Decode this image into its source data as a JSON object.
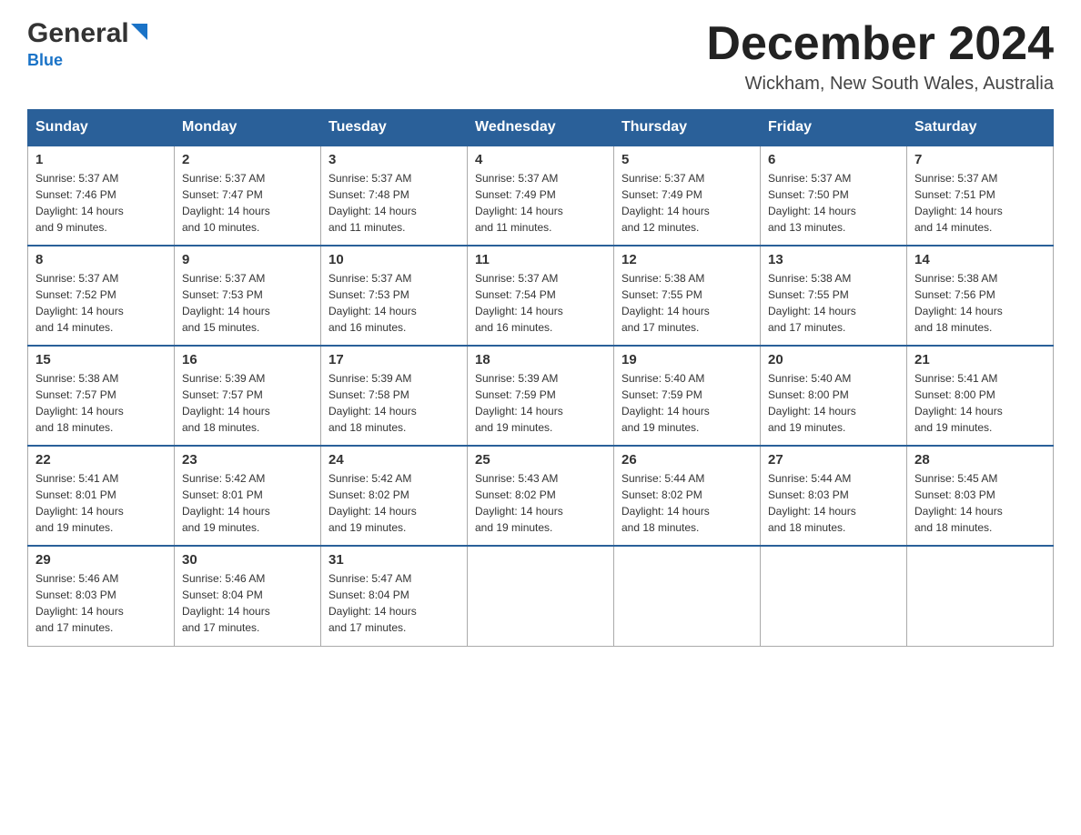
{
  "header": {
    "logo_general": "General",
    "logo_blue": "Blue",
    "month_title": "December 2024",
    "location": "Wickham, New South Wales, Australia"
  },
  "weekdays": [
    "Sunday",
    "Monday",
    "Tuesday",
    "Wednesday",
    "Thursday",
    "Friday",
    "Saturday"
  ],
  "weeks": [
    [
      {
        "day": "1",
        "sunrise": "5:37 AM",
        "sunset": "7:46 PM",
        "daylight": "14 hours and 9 minutes."
      },
      {
        "day": "2",
        "sunrise": "5:37 AM",
        "sunset": "7:47 PM",
        "daylight": "14 hours and 10 minutes."
      },
      {
        "day": "3",
        "sunrise": "5:37 AM",
        "sunset": "7:48 PM",
        "daylight": "14 hours and 11 minutes."
      },
      {
        "day": "4",
        "sunrise": "5:37 AM",
        "sunset": "7:49 PM",
        "daylight": "14 hours and 11 minutes."
      },
      {
        "day": "5",
        "sunrise": "5:37 AM",
        "sunset": "7:49 PM",
        "daylight": "14 hours and 12 minutes."
      },
      {
        "day": "6",
        "sunrise": "5:37 AM",
        "sunset": "7:50 PM",
        "daylight": "14 hours and 13 minutes."
      },
      {
        "day": "7",
        "sunrise": "5:37 AM",
        "sunset": "7:51 PM",
        "daylight": "14 hours and 14 minutes."
      }
    ],
    [
      {
        "day": "8",
        "sunrise": "5:37 AM",
        "sunset": "7:52 PM",
        "daylight": "14 hours and 14 minutes."
      },
      {
        "day": "9",
        "sunrise": "5:37 AM",
        "sunset": "7:53 PM",
        "daylight": "14 hours and 15 minutes."
      },
      {
        "day": "10",
        "sunrise": "5:37 AM",
        "sunset": "7:53 PM",
        "daylight": "14 hours and 16 minutes."
      },
      {
        "day": "11",
        "sunrise": "5:37 AM",
        "sunset": "7:54 PM",
        "daylight": "14 hours and 16 minutes."
      },
      {
        "day": "12",
        "sunrise": "5:38 AM",
        "sunset": "7:55 PM",
        "daylight": "14 hours and 17 minutes."
      },
      {
        "day": "13",
        "sunrise": "5:38 AM",
        "sunset": "7:55 PM",
        "daylight": "14 hours and 17 minutes."
      },
      {
        "day": "14",
        "sunrise": "5:38 AM",
        "sunset": "7:56 PM",
        "daylight": "14 hours and 18 minutes."
      }
    ],
    [
      {
        "day": "15",
        "sunrise": "5:38 AM",
        "sunset": "7:57 PM",
        "daylight": "14 hours and 18 minutes."
      },
      {
        "day": "16",
        "sunrise": "5:39 AM",
        "sunset": "7:57 PM",
        "daylight": "14 hours and 18 minutes."
      },
      {
        "day": "17",
        "sunrise": "5:39 AM",
        "sunset": "7:58 PM",
        "daylight": "14 hours and 18 minutes."
      },
      {
        "day": "18",
        "sunrise": "5:39 AM",
        "sunset": "7:59 PM",
        "daylight": "14 hours and 19 minutes."
      },
      {
        "day": "19",
        "sunrise": "5:40 AM",
        "sunset": "7:59 PM",
        "daylight": "14 hours and 19 minutes."
      },
      {
        "day": "20",
        "sunrise": "5:40 AM",
        "sunset": "8:00 PM",
        "daylight": "14 hours and 19 minutes."
      },
      {
        "day": "21",
        "sunrise": "5:41 AM",
        "sunset": "8:00 PM",
        "daylight": "14 hours and 19 minutes."
      }
    ],
    [
      {
        "day": "22",
        "sunrise": "5:41 AM",
        "sunset": "8:01 PM",
        "daylight": "14 hours and 19 minutes."
      },
      {
        "day": "23",
        "sunrise": "5:42 AM",
        "sunset": "8:01 PM",
        "daylight": "14 hours and 19 minutes."
      },
      {
        "day": "24",
        "sunrise": "5:42 AM",
        "sunset": "8:02 PM",
        "daylight": "14 hours and 19 minutes."
      },
      {
        "day": "25",
        "sunrise": "5:43 AM",
        "sunset": "8:02 PM",
        "daylight": "14 hours and 19 minutes."
      },
      {
        "day": "26",
        "sunrise": "5:44 AM",
        "sunset": "8:02 PM",
        "daylight": "14 hours and 18 minutes."
      },
      {
        "day": "27",
        "sunrise": "5:44 AM",
        "sunset": "8:03 PM",
        "daylight": "14 hours and 18 minutes."
      },
      {
        "day": "28",
        "sunrise": "5:45 AM",
        "sunset": "8:03 PM",
        "daylight": "14 hours and 18 minutes."
      }
    ],
    [
      {
        "day": "29",
        "sunrise": "5:46 AM",
        "sunset": "8:03 PM",
        "daylight": "14 hours and 17 minutes."
      },
      {
        "day": "30",
        "sunrise": "5:46 AM",
        "sunset": "8:04 PM",
        "daylight": "14 hours and 17 minutes."
      },
      {
        "day": "31",
        "sunrise": "5:47 AM",
        "sunset": "8:04 PM",
        "daylight": "14 hours and 17 minutes."
      },
      null,
      null,
      null,
      null
    ]
  ],
  "labels": {
    "sunrise": "Sunrise:",
    "sunset": "Sunset:",
    "daylight": "Daylight:"
  },
  "colors": {
    "header_bg": "#2a6099",
    "accent": "#1a73c7"
  }
}
